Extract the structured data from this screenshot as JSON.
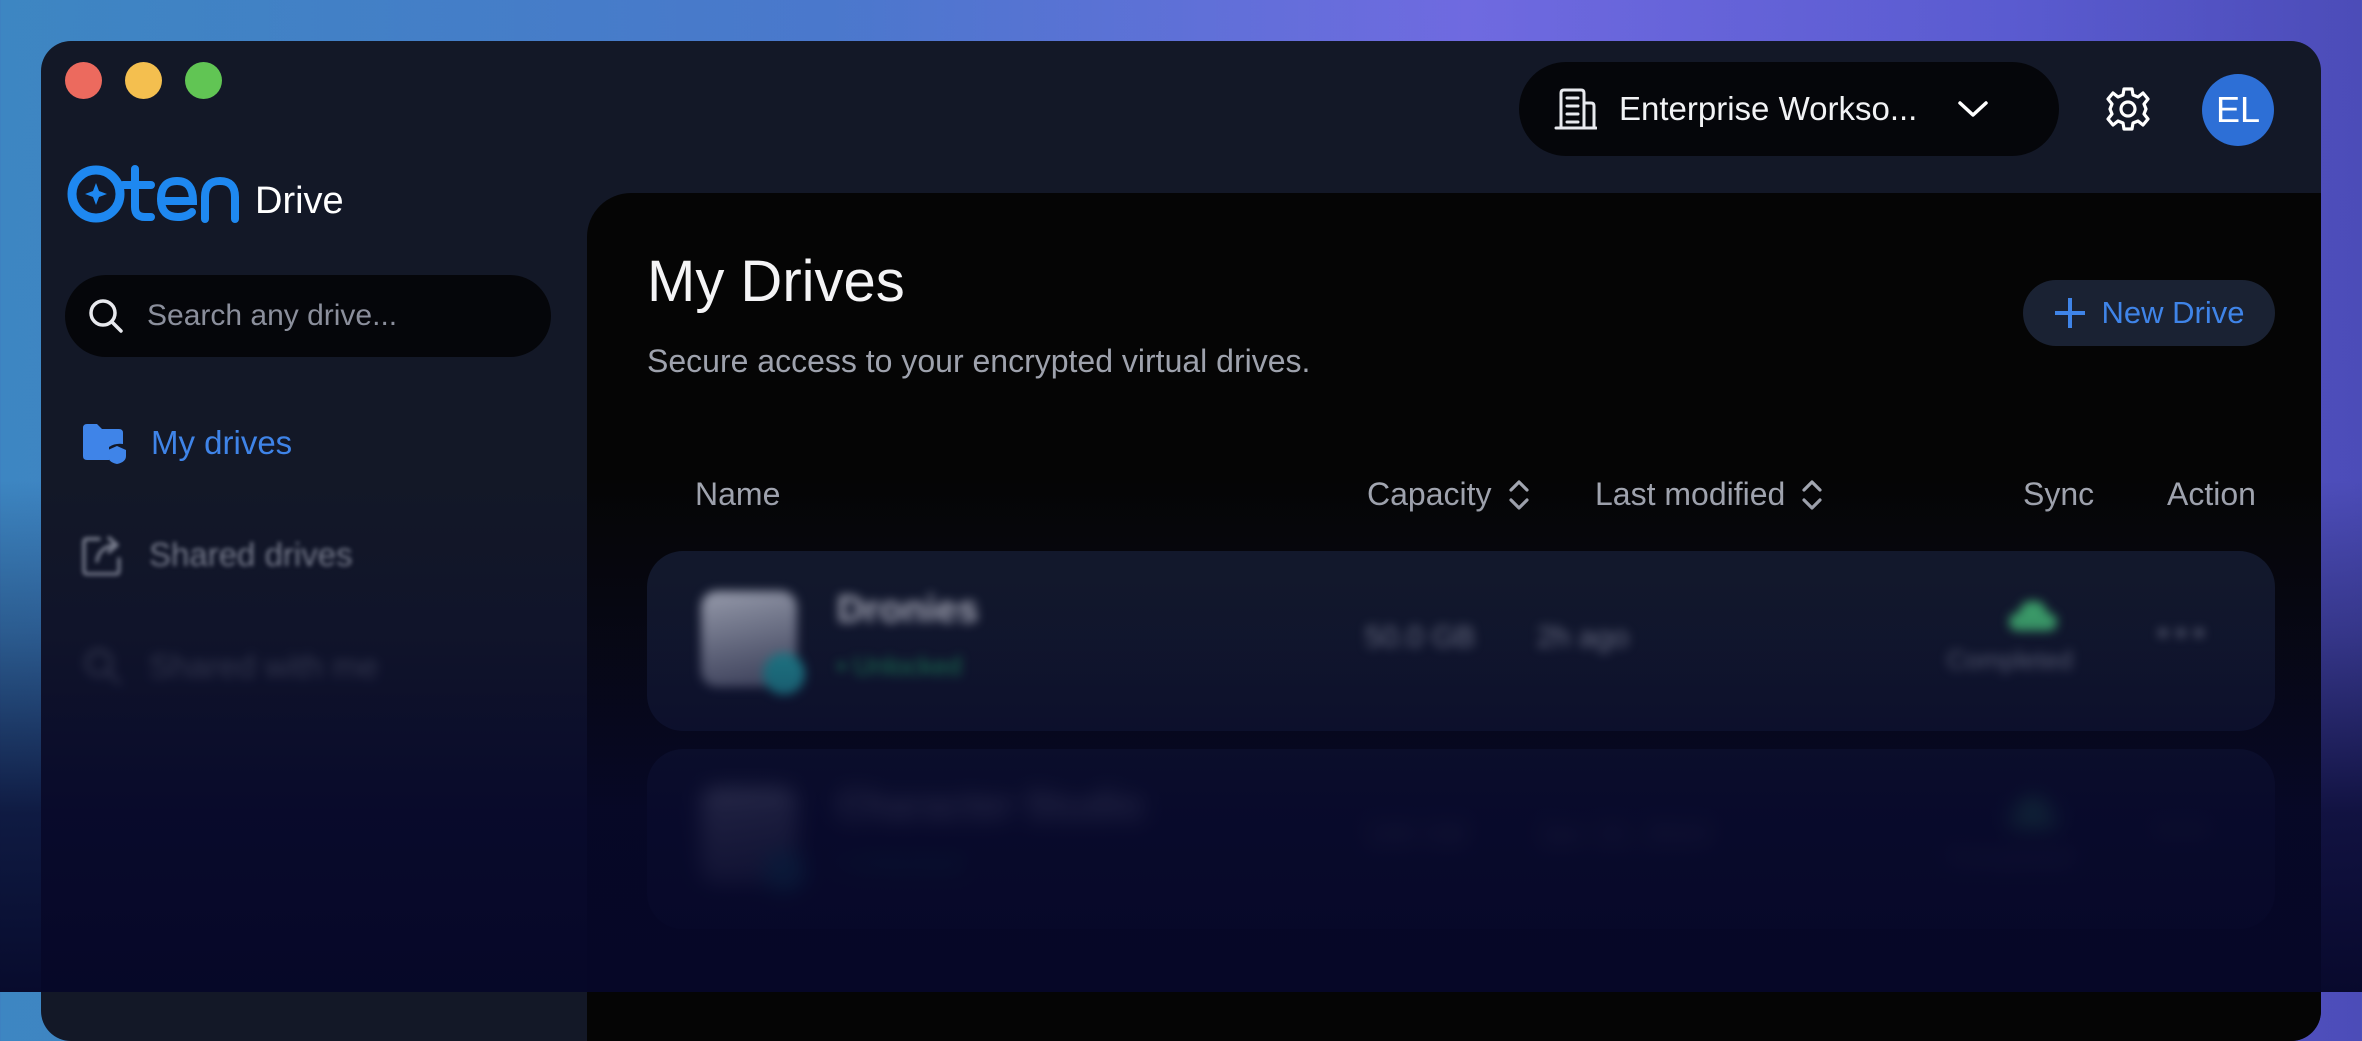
{
  "colors": {
    "accent": "#3f84e8",
    "window_bg": "#131827",
    "panel_bg": "#050505",
    "avatar_bg": "#2d6fd6",
    "success": "#27c46a",
    "sync_cloud": "#4fd680"
  },
  "window": {
    "controls": [
      "close",
      "minimize",
      "maximize"
    ]
  },
  "brand": {
    "logo_icon": "oten-logo-icon",
    "product_label": "Drive"
  },
  "sidebar": {
    "search": {
      "placeholder": "Search any drive...",
      "value": "",
      "icon": "search-icon"
    },
    "items": [
      {
        "label": "My drives",
        "icon": "folder-shield-icon",
        "active": true
      },
      {
        "label": "Shared drives",
        "icon": "share-icon",
        "active": false
      },
      {
        "label": "Shared with me",
        "icon": "user-search-icon",
        "active": false
      }
    ]
  },
  "header": {
    "workspace": {
      "label": "Enterprise Workso...",
      "icon": "building-icon",
      "chevron": "chevron-down-icon"
    },
    "settings_icon": "gear-icon",
    "avatar_initials": "EL"
  },
  "main": {
    "title": "My Drives",
    "subtitle": "Secure access to your encrypted virtual drives.",
    "new_drive_label": "New Drive",
    "columns": {
      "name": "Name",
      "capacity": "Capacity",
      "last_modified": "Last modified",
      "sync": "Sync",
      "action": "Action"
    },
    "rows": [
      {
        "name": "Dronies",
        "status": "• Unlocked",
        "capacity": "50.0 GB",
        "modified": "2h ago",
        "sync": "Completed"
      },
      {
        "name": "Character Studio",
        "status": "• Unlocked",
        "capacity": "100 GB",
        "modified": "Jan 15, 2024",
        "sync": "Completed"
      }
    ]
  }
}
